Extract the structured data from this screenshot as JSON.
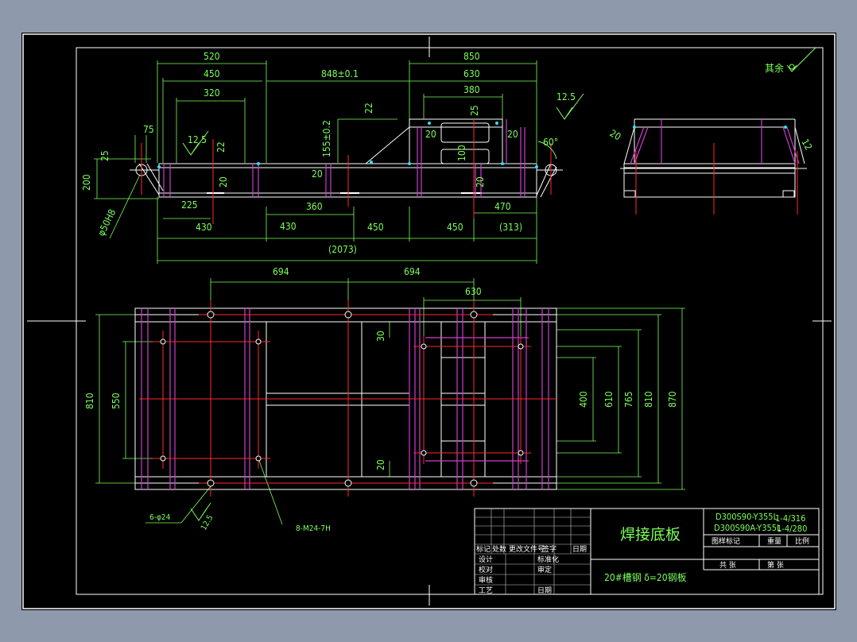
{
  "drawing": {
    "remark": "其余",
    "roughness": [
      "12.5",
      "12.5",
      "12.5",
      "12.5"
    ],
    "front_view": {
      "top_dims": [
        "520",
        "450",
        "848±0.1",
        "850",
        "630",
        "320",
        "380",
        "75",
        "22",
        "25",
        "20",
        "20"
      ],
      "side_dims": [
        "25",
        "200",
        "155±0.2",
        "22",
        "20",
        "20",
        "100",
        "20",
        "60°"
      ],
      "hole": "φ50H8",
      "bottom_dims": [
        "225",
        "360",
        "470",
        "430",
        "430",
        "450",
        "450",
        "(313)",
        "(2073)"
      ]
    },
    "side_view": {
      "dims": [
        "20",
        "12"
      ]
    },
    "plan_view": {
      "top_dims": [
        "694",
        "694",
        "630"
      ],
      "left_dims": [
        "810",
        "550"
      ],
      "inner_dims": [
        "30",
        "20"
      ],
      "right_dims": [
        "400",
        "610",
        "765",
        "810",
        "870"
      ],
      "holes_left": "6-φ24",
      "holes_right": "8-M24-7H",
      "rough": "12.5"
    },
    "title_block": {
      "title": "焊接底板",
      "material": "20#槽钢  δ=20钢板",
      "models": [
        "D300S90-Y355L",
        "D300S90A-Y355L"
      ],
      "model_suffix": [
        "1-4/316",
        "1-4/280"
      ],
      "header_cells": [
        "图样标记",
        "重量",
        "比例"
      ],
      "sheet_cells": [
        "共  张",
        "第  张"
      ],
      "rev_header": [
        "标记",
        "处数",
        "更改文件号",
        "签字",
        "日期"
      ],
      "roles": [
        "设计",
        "校对",
        "审核",
        "工艺"
      ],
      "roles_right": [
        "标准化",
        "审定",
        "日期"
      ]
    }
  }
}
